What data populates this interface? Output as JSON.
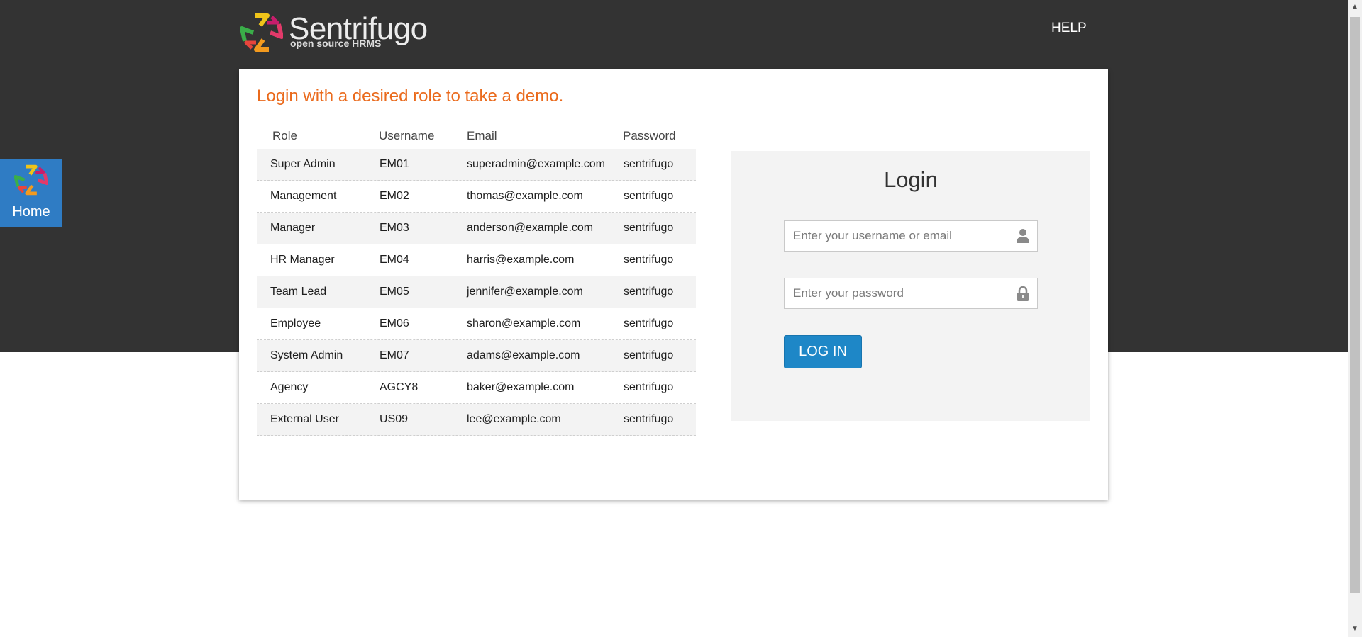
{
  "header": {
    "brand_name": "Sentrifugo",
    "brand_tagline": "open source HRMS",
    "logo_icon": "sentrifugo-logo-icon",
    "help_label": "HELP"
  },
  "side_tab": {
    "label": "Home",
    "icon": "sentrifugo-logo-icon"
  },
  "demo": {
    "intro": "Login with a desired role to take a demo.",
    "columns": [
      "Role",
      "Username",
      "Email",
      "Password"
    ],
    "rows": [
      [
        "Super Admin",
        "EM01",
        "superadmin@example.com",
        "sentrifugo"
      ],
      [
        "Management",
        "EM02",
        "thomas@example.com",
        "sentrifugo"
      ],
      [
        "Manager",
        "EM03",
        "anderson@example.com",
        "sentrifugo"
      ],
      [
        "HR Manager",
        "EM04",
        "harris@example.com",
        "sentrifugo"
      ],
      [
        "Team Lead",
        "EM05",
        "jennifer@example.com",
        "sentrifugo"
      ],
      [
        "Employee",
        "EM06",
        "sharon@example.com",
        "sentrifugo"
      ],
      [
        "System Admin",
        "EM07",
        "adams@example.com",
        "sentrifugo"
      ],
      [
        "Agency",
        "AGCY8",
        "baker@example.com",
        "sentrifugo"
      ],
      [
        "External User",
        "US09",
        "lee@example.com",
        "sentrifugo"
      ]
    ]
  },
  "login": {
    "title": "Login",
    "username_placeholder": "Enter your username or email",
    "username_value": "",
    "username_icon": "user-icon",
    "password_placeholder": "Enter your password",
    "password_value": "",
    "password_icon": "lock-icon",
    "submit_label": "LOG IN"
  },
  "colors": {
    "header_bg": "#333333",
    "accent_orange": "#ea6a1c",
    "button_blue": "#1e87c7",
    "home_tab_blue": "#2f7cc4"
  }
}
